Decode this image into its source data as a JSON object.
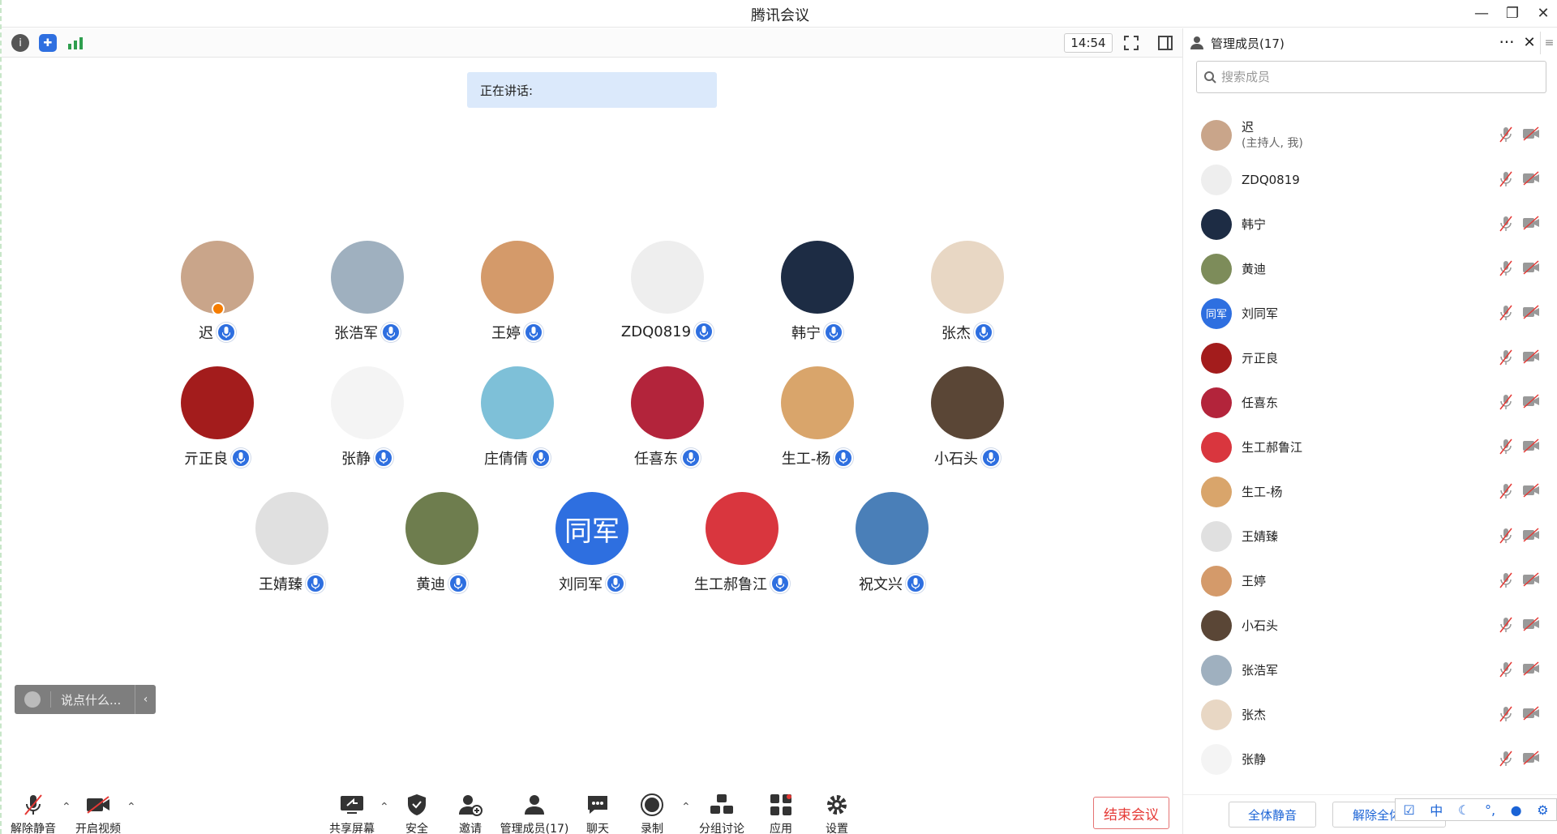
{
  "window": {
    "title": "腾讯会议",
    "minimize": "—",
    "restore": "❐",
    "close": "✕"
  },
  "topbar": {
    "time": "14:54",
    "info_icon": "info-icon",
    "shield_icon": "shield-icon",
    "signal_icon": "signal-icon"
  },
  "speaking": {
    "label": "正在讲话:"
  },
  "participants": [
    {
      "name": "迟",
      "host": true
    },
    {
      "name": "张浩军"
    },
    {
      "name": "王婷"
    },
    {
      "name": "ZDQ0819"
    },
    {
      "name": "韩宁"
    },
    {
      "name": "张杰"
    },
    {
      "name": "亓正良"
    },
    {
      "name": "张静"
    },
    {
      "name": "庄倩倩"
    },
    {
      "name": "任喜东"
    },
    {
      "name": "生工-杨"
    },
    {
      "name": "小石头"
    },
    {
      "name": "王婧臻"
    },
    {
      "name": "黄迪"
    },
    {
      "name": "刘同军",
      "avatar_text": "同军"
    },
    {
      "name": "生工郝鲁江"
    },
    {
      "name": "祝文兴"
    }
  ],
  "chat": {
    "placeholder": "说点什么..."
  },
  "toolbar": {
    "unmute": "解除静音",
    "video": "开启视频",
    "share": "共享屏幕",
    "security": "安全",
    "invite": "邀请",
    "manage": "管理成员(17)",
    "chat": "聊天",
    "record": "录制",
    "breakout": "分组讨论",
    "apps": "应用",
    "settings": "设置",
    "end": "结束会议"
  },
  "panel": {
    "title": "管理成员(17)",
    "more": "···",
    "close": "✕",
    "menu": "≡",
    "search_placeholder": "搜索成员",
    "members": [
      {
        "name": "迟",
        "sub": "(主持人, 我)"
      },
      {
        "name": "ZDQ0819"
      },
      {
        "name": "韩宁"
      },
      {
        "name": "黄迪"
      },
      {
        "name": "刘同军",
        "avatar_text": "同军"
      },
      {
        "name": "亓正良"
      },
      {
        "name": "任喜东"
      },
      {
        "name": "生工郝鲁江"
      },
      {
        "name": "生工-杨"
      },
      {
        "name": "王婧臻"
      },
      {
        "name": "王婷"
      },
      {
        "name": "小石头"
      },
      {
        "name": "张浩军"
      },
      {
        "name": "张杰"
      },
      {
        "name": "张静"
      }
    ],
    "mute_all": "全体静音",
    "unmute_all": "解除全体静音"
  },
  "ime": {
    "mode": "中"
  },
  "colors": {
    "accent": "#2e6fe0",
    "end": "#e53935",
    "speaking_bg": "#dbe9fb"
  }
}
